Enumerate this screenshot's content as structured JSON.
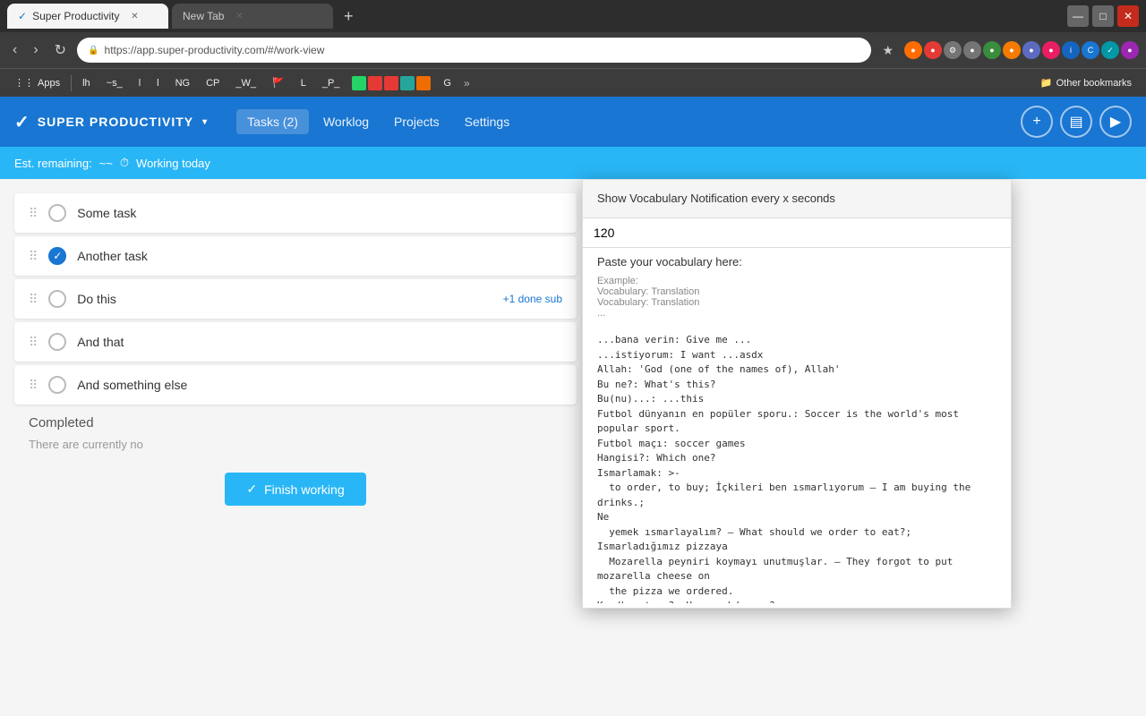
{
  "browser": {
    "tabs": [
      {
        "label": "Super Productivity",
        "active": true,
        "favicon": "✓"
      },
      {
        "label": "New Tab",
        "active": false
      }
    ],
    "url": "https://app.super-productivity.com/#/work-view",
    "new_tab_label": "+",
    "window_controls": {
      "minimize": "—",
      "maximize": "□",
      "close": "✕"
    }
  },
  "bookmarks": [
    {
      "label": "Apps"
    },
    {
      "label": "lh"
    },
    {
      "label": "~s_"
    },
    {
      "label": "l"
    },
    {
      "label": "l"
    },
    {
      "label": "NG"
    },
    {
      "label": "CP"
    },
    {
      "label": "_W_"
    },
    {
      "label": "L"
    },
    {
      "label": "_P_"
    },
    {
      "label": "G"
    }
  ],
  "other_bookmarks": "Other bookmarks",
  "header": {
    "logo_check": "✓",
    "app_title": "SUPER PRODUCTIVITY",
    "dropdown_arrow": "▾",
    "tasks_label": "Tasks (2)",
    "worklog_label": "Worklog",
    "projects_label": "Projects",
    "settings_label": "Settings",
    "add_icon": "+",
    "file_icon": "▤",
    "play_icon": "▶"
  },
  "working_bar": {
    "est_remaining_label": "Est. remaining:",
    "est_value": "~~",
    "timer_icon": "⏱",
    "working_today_label": "Working today"
  },
  "tasks": [
    {
      "id": 1,
      "text": "Some task",
      "done": false
    },
    {
      "id": 2,
      "text": "Another task",
      "done": true
    },
    {
      "id": 3,
      "text": "Do this",
      "done": false,
      "sub_info": "+1 done sub"
    },
    {
      "id": 4,
      "text": "And that",
      "done": false
    },
    {
      "id": 5,
      "text": "And something else",
      "done": false
    }
  ],
  "completed_section": {
    "title": "Completed",
    "no_tasks_message": "There are currently no"
  },
  "finish_button": {
    "label": "Finish working",
    "icon": "✓"
  },
  "vocab_popup": {
    "title": "Show Vocabulary Notification every x seconds",
    "interval_value": "120",
    "paste_label": "Paste your vocabulary here:",
    "example_label": "Example:",
    "example_line1": "Vocabulary: Translation",
    "example_line2": "Vocabulary: Translation",
    "example_ellipsis": "...",
    "content": "...bana verin: Give me ...\n...istiyorum: I want ...asdx\nAllah: 'God (one of the names of), Allah'\nBu ne?: What's this?\nBu(nu)...: ...this\nFutbol dünyanın en popüler sporu.: Soccer is the world's most popular sport.\nFutbol maçı: soccer games\nHangisi?: Which one?\nIsmarlamak: >-\n  to order, to buy; İçkileri ben ısmarlıyorum — I am buying the drinks.;\nNe\n  yemek ısmarlayalım? — What should we order to eat?; Ismarladığımız pizzaya\n  Mozarella peyniri koymayı unutmuşlar. — They forgot to put mozarella cheese on\n  the pizza we ordered.\nKaç/kaç tane?: How much/ many?\nNe demek?: What does it mean?\nNe zaman?: When?\n'Niçin [or] neden?': Why?\nO(nu)...: ...the other\nSporcular futbol oynuyorlar.: The players are playing soccer.\nacı: 'pain, sting, sorrow, grief, suffering; bitter, sad, acrimonious, hot'\nad: 'name, given name, reputation'\nadam: 'man, guy, chap'"
  }
}
